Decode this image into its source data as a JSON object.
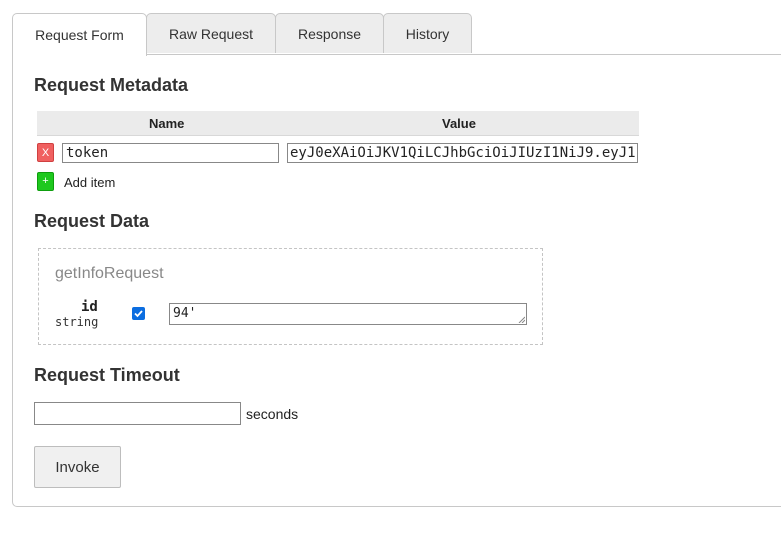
{
  "tabs": [
    {
      "label": "Request Form",
      "active": true
    },
    {
      "label": "Raw Request",
      "active": false
    },
    {
      "label": "Response",
      "active": false
    },
    {
      "label": "History",
      "active": false
    }
  ],
  "metadata": {
    "heading": "Request Metadata",
    "col_name": "Name",
    "col_value": "Value",
    "rows": [
      {
        "remove_label": "X",
        "name": "token",
        "value": "eyJ0eXAiOiJKV1QiLCJhbGciOiJIUzI1NiJ9.eyJ1"
      }
    ],
    "add_label": "+",
    "add_text": "Add item"
  },
  "request_data": {
    "heading": "Request Data",
    "message_type": "getInfoRequest",
    "fields": [
      {
        "name": "id",
        "type": "string",
        "checked": true,
        "value": "94'"
      }
    ]
  },
  "timeout": {
    "heading": "Request Timeout",
    "value": "",
    "unit": "seconds"
  },
  "invoke_label": "Invoke",
  "colors": {
    "remove": "#f06060",
    "add": "#1ec81e",
    "checkbox": "#0b6de0"
  }
}
